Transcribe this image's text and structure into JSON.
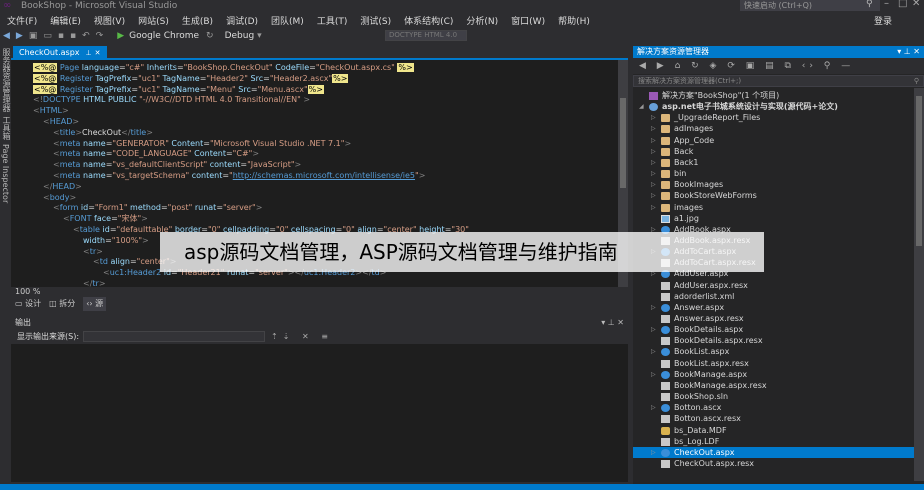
{
  "window": {
    "title": "BookShop - Microsoft Visual Studio",
    "quick_launch_placeholder": "快速启动 (Ctrl+Q)",
    "login_label": "登录"
  },
  "menu": [
    "文件(F)",
    "编辑(E)",
    "视图(V)",
    "网站(S)",
    "生成(B)",
    "调试(D)",
    "团队(M)",
    "工具(T)",
    "测试(S)",
    "体系结构(C)",
    "分析(N)",
    "窗口(W)",
    "帮助(H)"
  ],
  "toolbar": {
    "run_label": "Google Chrome",
    "config_label": "Debug",
    "find_placeholder": "DOCTYPE HTML 4.0"
  },
  "left_strip": [
    "服务器资源管理器",
    "工具箱",
    "Page Inspector"
  ],
  "editor": {
    "tab_label": "CheckOut.aspx",
    "zoom": "100 %",
    "views": [
      {
        "label": "设计",
        "active": false
      },
      {
        "label": "拆分",
        "active": false
      },
      {
        "label": "源",
        "active": true
      }
    ]
  },
  "code_lines": [
    {
      "indent": 0,
      "parts": [
        [
          "aspx",
          "<%@"
        ],
        [
          "dir",
          " Page "
        ],
        [
          "att",
          "language"
        ],
        [
          "txt",
          "="
        ],
        [
          "str",
          "\"c#\""
        ],
        [
          "att",
          " Inherits"
        ],
        [
          "txt",
          "="
        ],
        [
          "str",
          "\"BookShop.CheckOut\""
        ],
        [
          "att",
          " CodeFile"
        ],
        [
          "txt",
          "="
        ],
        [
          "str",
          "\"CheckOut.aspx.cs\" "
        ],
        [
          "aspx",
          "%>"
        ]
      ]
    },
    {
      "indent": 0,
      "parts": [
        [
          "aspx",
          "<%@"
        ],
        [
          "dir",
          " Register "
        ],
        [
          "att",
          "TagPrefix"
        ],
        [
          "txt",
          "="
        ],
        [
          "str",
          "\"uc1\""
        ],
        [
          "att",
          " TagName"
        ],
        [
          "txt",
          "="
        ],
        [
          "str",
          "\"Header2\""
        ],
        [
          "att",
          " Src"
        ],
        [
          "txt",
          "="
        ],
        [
          "str",
          "\"Header2.ascx\""
        ],
        [
          "aspx",
          "%>"
        ]
      ]
    },
    {
      "indent": 0,
      "parts": [
        [
          "aspx",
          "<%@"
        ],
        [
          "dir",
          " Register "
        ],
        [
          "att",
          "TagPrefix"
        ],
        [
          "txt",
          "="
        ],
        [
          "str",
          "\"uc1\""
        ],
        [
          "att",
          " TagName"
        ],
        [
          "txt",
          "="
        ],
        [
          "str",
          "\"Menu\""
        ],
        [
          "att",
          " Src"
        ],
        [
          "txt",
          "="
        ],
        [
          "str",
          "\"Menu.ascx\""
        ],
        [
          "aspx",
          "%>"
        ]
      ]
    },
    {
      "indent": 0,
      "parts": [
        [
          "brk",
          "<!"
        ],
        [
          "tag",
          "DOCTYPE"
        ],
        [
          "att",
          " HTML "
        ],
        [
          "att",
          "PUBLIC"
        ],
        [
          "str",
          " \"-//W3C//DTD HTML 4.0 Transitional//EN\" "
        ],
        [
          "brk",
          ">"
        ]
      ]
    },
    {
      "indent": 0,
      "parts": [
        [
          "brk",
          "<"
        ],
        [
          "tag",
          "HTML"
        ],
        [
          "brk",
          ">"
        ]
      ]
    },
    {
      "indent": 1,
      "parts": [
        [
          "brk",
          "<"
        ],
        [
          "tag",
          "HEAD"
        ],
        [
          "brk",
          ">"
        ]
      ]
    },
    {
      "indent": 2,
      "parts": [
        [
          "brk",
          "<"
        ],
        [
          "tag",
          "title"
        ],
        [
          "brk",
          ">"
        ],
        [
          "txt",
          "CheckOut"
        ],
        [
          "brk",
          "</"
        ],
        [
          "tag",
          "title"
        ],
        [
          "brk",
          ">"
        ]
      ]
    },
    {
      "indent": 2,
      "parts": [
        [
          "brk",
          "<"
        ],
        [
          "tag",
          "meta"
        ],
        [
          "att",
          " name"
        ],
        [
          "txt",
          "="
        ],
        [
          "str",
          "\"GENERATOR\""
        ],
        [
          "att",
          " Content"
        ],
        [
          "txt",
          "="
        ],
        [
          "str",
          "\"Microsoft Visual Studio .NET 7.1\""
        ],
        [
          "brk",
          ">"
        ]
      ]
    },
    {
      "indent": 2,
      "parts": [
        [
          "brk",
          "<"
        ],
        [
          "tag",
          "meta"
        ],
        [
          "att",
          " name"
        ],
        [
          "txt",
          "="
        ],
        [
          "str",
          "\"CODE_LANGUAGE\""
        ],
        [
          "att",
          " Content"
        ],
        [
          "txt",
          "="
        ],
        [
          "str",
          "\"C#\""
        ],
        [
          "brk",
          ">"
        ]
      ]
    },
    {
      "indent": 2,
      "parts": [
        [
          "brk",
          "<"
        ],
        [
          "tag",
          "meta"
        ],
        [
          "att",
          " name"
        ],
        [
          "txt",
          "="
        ],
        [
          "str",
          "\"vs_defaultClientScript\""
        ],
        [
          "att",
          " content"
        ],
        [
          "txt",
          "="
        ],
        [
          "str",
          "\"JavaScript\""
        ],
        [
          "brk",
          ">"
        ]
      ]
    },
    {
      "indent": 2,
      "parts": [
        [
          "brk",
          "<"
        ],
        [
          "tag",
          "meta"
        ],
        [
          "att",
          " name"
        ],
        [
          "txt",
          "="
        ],
        [
          "str",
          "\"vs_targetSchema\""
        ],
        [
          "att",
          " content"
        ],
        [
          "txt",
          "="
        ],
        [
          "str",
          "\""
        ],
        [
          "link",
          "http://schemas.microsoft.com/intellisense/ie5"
        ],
        [
          "str",
          "\""
        ],
        [
          "brk",
          ">"
        ]
      ]
    },
    {
      "indent": 1,
      "parts": [
        [
          "brk",
          "</"
        ],
        [
          "tag",
          "HEAD"
        ],
        [
          "brk",
          ">"
        ]
      ]
    },
    {
      "indent": 1,
      "parts": [
        [
          "brk",
          "<"
        ],
        [
          "tag",
          "body"
        ],
        [
          "brk",
          ">"
        ]
      ]
    },
    {
      "indent": 2,
      "parts": [
        [
          "brk",
          "<"
        ],
        [
          "tag",
          "form"
        ],
        [
          "att",
          " id"
        ],
        [
          "txt",
          "="
        ],
        [
          "str",
          "\"Form1\""
        ],
        [
          "att",
          " method"
        ],
        [
          "txt",
          "="
        ],
        [
          "str",
          "\"post\""
        ],
        [
          "att",
          " runat"
        ],
        [
          "txt",
          "="
        ],
        [
          "str",
          "\"server\""
        ],
        [
          "brk",
          ">"
        ]
      ]
    },
    {
      "indent": 3,
      "parts": [
        [
          "brk",
          "<"
        ],
        [
          "tag",
          "FONT"
        ],
        [
          "att",
          " face"
        ],
        [
          "txt",
          "="
        ],
        [
          "str",
          "\"宋体\""
        ],
        [
          "brk",
          ">"
        ]
      ]
    },
    {
      "indent": 4,
      "parts": [
        [
          "brk",
          "<"
        ],
        [
          "tag",
          "table"
        ],
        [
          "att",
          " id"
        ],
        [
          "txt",
          "="
        ],
        [
          "str",
          "\"defaulttable\""
        ],
        [
          "att",
          " border"
        ],
        [
          "txt",
          "="
        ],
        [
          "str",
          "\"0\""
        ],
        [
          "att",
          " cellpadding"
        ],
        [
          "txt",
          "="
        ],
        [
          "str",
          "\"0\""
        ],
        [
          "att",
          " cellspacing"
        ],
        [
          "txt",
          "="
        ],
        [
          "str",
          "\"0\""
        ],
        [
          "att",
          " align"
        ],
        [
          "txt",
          "="
        ],
        [
          "str",
          "\"center\""
        ],
        [
          "att",
          " height"
        ],
        [
          "txt",
          "="
        ],
        [
          "str",
          "\"30\""
        ]
      ]
    },
    {
      "indent": 5,
      "parts": [
        [
          "att",
          "width"
        ],
        [
          "txt",
          "="
        ],
        [
          "str",
          "\"100%\""
        ],
        [
          "brk",
          ">"
        ]
      ]
    },
    {
      "indent": 5,
      "parts": [
        [
          "brk",
          "<"
        ],
        [
          "tag",
          "tr"
        ],
        [
          "brk",
          ">"
        ]
      ]
    },
    {
      "indent": 6,
      "parts": [
        [
          "brk",
          "<"
        ],
        [
          "tag",
          "td"
        ],
        [
          "att",
          " align"
        ],
        [
          "txt",
          "="
        ],
        [
          "str",
          "\"center\""
        ],
        [
          "brk",
          ">"
        ]
      ]
    },
    {
      "indent": 7,
      "parts": [
        [
          "brk",
          "<"
        ],
        [
          "tag",
          "uc1:Header2"
        ],
        [
          "att",
          " id"
        ],
        [
          "txt",
          "="
        ],
        [
          "str",
          "\"Header21\""
        ],
        [
          "att",
          " runat"
        ],
        [
          "txt",
          "="
        ],
        [
          "str",
          "\"server\""
        ],
        [
          "brk",
          "></"
        ],
        [
          "tag",
          "uc1:Header2"
        ],
        [
          "brk",
          "></"
        ],
        [
          "tag",
          "td"
        ],
        [
          "brk",
          ">"
        ]
      ]
    },
    {
      "indent": 5,
      "parts": [
        [
          "brk",
          "</"
        ],
        [
          "tag",
          "tr"
        ],
        [
          "brk",
          ">"
        ]
      ]
    }
  ],
  "output": {
    "title": "输出",
    "source_label": "显示输出来源(S):"
  },
  "solution_explorer": {
    "title": "解决方案资源管理器",
    "search_placeholder": "搜索解决方案资源管理器(Ctrl+;)",
    "items": [
      {
        "label": "解决方案\"BookShop\"(1 个项目)",
        "type": "sln",
        "level": 0,
        "arrow": ""
      },
      {
        "label": "asp.net电子书城系统设计与实现(源代码+论文)",
        "type": "globe",
        "level": 0,
        "arrow": "◢",
        "bold": true
      },
      {
        "label": "_UpgradeReport_Files",
        "type": "folder",
        "level": 1,
        "arrow": "▷"
      },
      {
        "label": "adImages",
        "type": "folder",
        "level": 1,
        "arrow": "▷"
      },
      {
        "label": "App_Code",
        "type": "folder",
        "level": 1,
        "arrow": "▷"
      },
      {
        "label": "Back",
        "type": "folder",
        "level": 1,
        "arrow": "▷"
      },
      {
        "label": "Back1",
        "type": "folder",
        "level": 1,
        "arrow": "▷"
      },
      {
        "label": "bin",
        "type": "folder",
        "level": 1,
        "arrow": "▷"
      },
      {
        "label": "BookImages",
        "type": "folder",
        "level": 1,
        "arrow": "▷"
      },
      {
        "label": "BookStoreWebForms",
        "type": "folder",
        "level": 1,
        "arrow": "▷"
      },
      {
        "label": "images",
        "type": "folder",
        "level": 1,
        "arrow": "▷"
      },
      {
        "label": "a1.jpg",
        "type": "img",
        "level": 1,
        "arrow": ""
      },
      {
        "label": "AddBook.aspx",
        "type": "aspx",
        "level": 1,
        "arrow": "▷"
      },
      {
        "label": "AddBook.aspx.resx",
        "type": "file",
        "level": 1,
        "arrow": ""
      },
      {
        "label": "AddToCart.aspx",
        "type": "aspx",
        "level": 1,
        "arrow": "▷"
      },
      {
        "label": "AddToCart.aspx.resx",
        "type": "file",
        "level": 1,
        "arrow": ""
      },
      {
        "label": "AddUser.aspx",
        "type": "aspx",
        "level": 1,
        "arrow": "▷"
      },
      {
        "label": "AddUser.aspx.resx",
        "type": "file",
        "level": 1,
        "arrow": ""
      },
      {
        "label": "adorderlist.xml",
        "type": "file",
        "level": 1,
        "arrow": ""
      },
      {
        "label": "Answer.aspx",
        "type": "aspx",
        "level": 1,
        "arrow": "▷"
      },
      {
        "label": "Answer.aspx.resx",
        "type": "file",
        "level": 1,
        "arrow": ""
      },
      {
        "label": "BookDetails.aspx",
        "type": "aspx",
        "level": 1,
        "arrow": "▷"
      },
      {
        "label": "BookDetails.aspx.resx",
        "type": "file",
        "level": 1,
        "arrow": ""
      },
      {
        "label": "BookList.aspx",
        "type": "aspx",
        "level": 1,
        "arrow": "▷"
      },
      {
        "label": "BookList.aspx.resx",
        "type": "file",
        "level": 1,
        "arrow": ""
      },
      {
        "label": "BookManage.aspx",
        "type": "aspx",
        "level": 1,
        "arrow": "▷"
      },
      {
        "label": "BookManage.aspx.resx",
        "type": "file",
        "level": 1,
        "arrow": ""
      },
      {
        "label": "BookShop.sln",
        "type": "file",
        "level": 1,
        "arrow": ""
      },
      {
        "label": "Botton.ascx",
        "type": "aspx",
        "level": 1,
        "arrow": "▷"
      },
      {
        "label": "Botton.ascx.resx",
        "type": "file",
        "level": 1,
        "arrow": ""
      },
      {
        "label": "bs_Data.MDF",
        "type": "db",
        "level": 1,
        "arrow": ""
      },
      {
        "label": "bs_Log.LDF",
        "type": "file",
        "level": 1,
        "arrow": ""
      },
      {
        "label": "CheckOut.aspx",
        "type": "aspx",
        "level": 1,
        "arrow": "▷",
        "selected": true
      },
      {
        "label": "CheckOut.aspx.resx",
        "type": "file",
        "level": 1,
        "arrow": ""
      }
    ]
  },
  "overlay_text": "asp源码文档管理，ASP源码文档管理与维护指南",
  "colors": {
    "accent": "#007acc",
    "editor_bg": "#1e1e1e",
    "chrome_bg": "#2d2d30"
  }
}
